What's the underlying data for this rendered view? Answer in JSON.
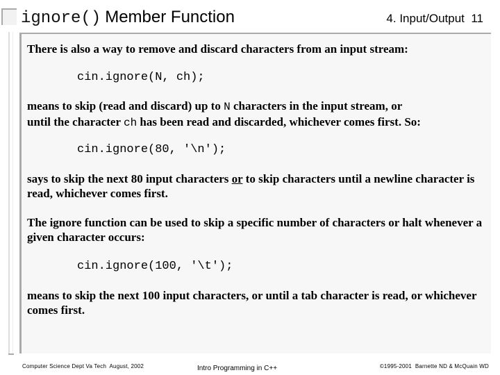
{
  "slide": {
    "title_code": "ignore()",
    "title_text": "Member Function",
    "chapter": "4. Input/Output",
    "page_number": "11"
  },
  "content": {
    "p1": "There is also a way to remove and discard characters from an input stream:",
    "code1": "cin.ignore(N, ch);",
    "p2": {
      "part1": "means to skip (read and discard) up to ",
      "code_a": "N",
      "part2": " characters in the input stream, or",
      "part3": "until the character ",
      "code_b": "ch",
      "part4": " has been read and discarded, whichever comes first.  So:"
    },
    "code2": "cin.ignore(80, '\\n');",
    "p3": {
      "part1": "says to skip the next 80 input characters ",
      "underlined": "or",
      "part2": " to skip characters until a newline character is",
      "part3": "read, whichever comes first."
    },
    "p4": {
      "line1": "The ignore function can be used to skip a specific number of characters or halt whenever a",
      "line2": "given character occurs:"
    },
    "code3": "cin.ignore(100, '\\t');",
    "p5": {
      "line1": "means to skip the next 100 input characters, or until a tab character is read, or whichever",
      "line2": "comes first."
    }
  },
  "footer": {
    "left": "Computer Science Dept Va Tech  August, 2002",
    "center": "Intro Programming in C++",
    "right": "©1995-2001  Barnette ND & McQuain WD"
  },
  "colors": {
    "border": "#aaaaaa",
    "content_bg": "#f7f7f7"
  }
}
